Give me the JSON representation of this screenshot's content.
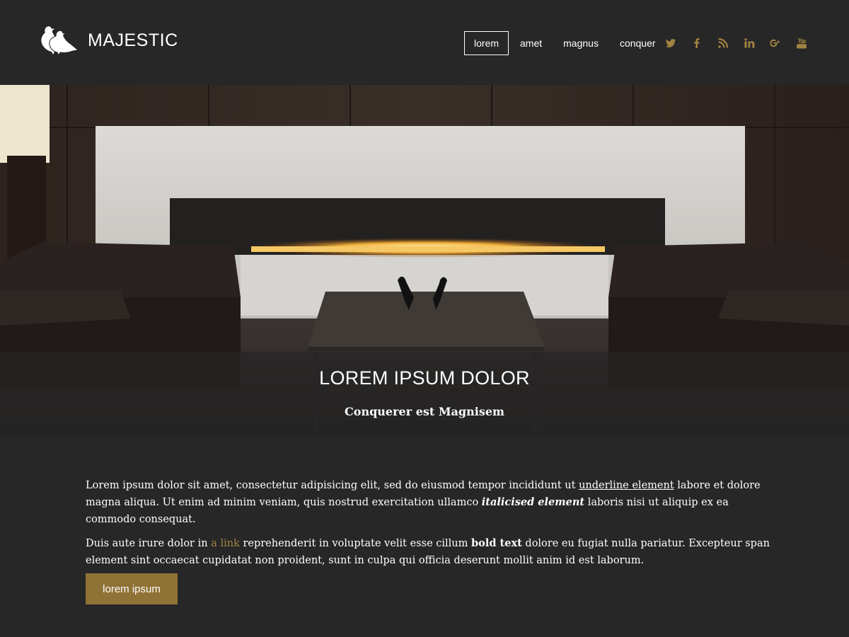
{
  "brand": {
    "logo_text": "MAJESTIC",
    "logo_icon": "two-birds-icon"
  },
  "nav": {
    "items": [
      {
        "label": "lorem",
        "active": true
      },
      {
        "label": "amet",
        "active": false
      },
      {
        "label": "magnus",
        "active": false
      },
      {
        "label": "conquer",
        "active": false
      }
    ]
  },
  "social": {
    "color": "#a08343",
    "icons": [
      "twitter-icon",
      "facebook-icon",
      "rss-icon",
      "linkedin-icon",
      "google-plus-icon",
      "youtube-icon"
    ]
  },
  "hero": {
    "title": "LOREM IPSUM DOLOR",
    "subtitle": "Conquerer est Magnisem"
  },
  "content": {
    "p1": {
      "t1": "Lorem ipsum dolor sit amet, consectetur adipisicing elit, sed do eiusmod tempor incididunt ut ",
      "underline": "underline element",
      "t2": " labore et dolore magna aliqua. Ut enim ad minim veniam, quis nostrud exercitation ullamco ",
      "italic": "italicised element",
      "t3": " laboris nisi ut aliquip ex ea commodo consequat."
    },
    "p2": {
      "t1": "Duis aute irure dolor in ",
      "link": "a link",
      "t2": " reprehenderit in voluptate velit esse cillum ",
      "bold": "bold text",
      "t3": " dolore eu fugiat nulla pariatur. Excepteur span element sint occaecat cupidatat non proident, sunt in culpa qui officia deserunt mollit anim id est laborum."
    }
  },
  "cta": {
    "label": "lorem ipsum"
  },
  "colors": {
    "background": "#272727",
    "accent": "#8f7235",
    "link": "#a08343"
  }
}
